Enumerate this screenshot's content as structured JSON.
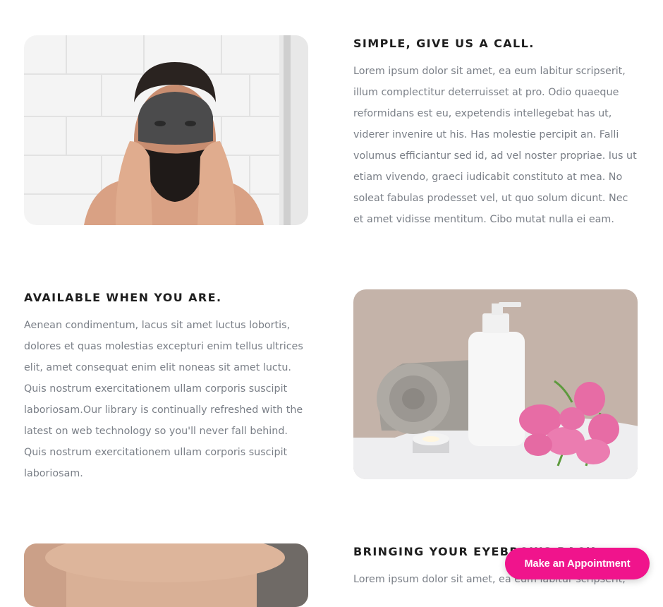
{
  "sections": [
    {
      "title": "SIMPLE, GIVE US A CALL.",
      "body": "Lorem ipsum dolor sit amet, ea eum labitur scripserit, illum complectitur deterruisset at pro. Odio quaeque reformidans est eu, expetendis intellegebat has ut, viderer invenire ut his. Has molestie percipit an. Falli volumus efficiantur sed id, ad vel noster propriae. Ius ut etiam vivendo, graeci iudicabit constituto at mea. No soleat fabulas prodesset vel, ut quo solum dicunt. Nec et amet vidisse mentitum. Cibo mutat nulla ei eam."
    },
    {
      "title": "AVAILABLE WHEN YOU ARE.",
      "body": "Aenean condimentum, lacus sit amet luctus lobortis, dolores et quas molestias excepturi enim tellus ultrices elit, amet consequat enim elit noneas sit amet luctu. Quis nostrum exercitationem ullam corporis suscipit laboriosam.Our library is continually refreshed with the latest on web technology so you'll never fall behind. Quis nostrum exercitationem ullam corporis suscipit laboriosam."
    },
    {
      "title": "BRINGING YOUR EYEBROWS BACK",
      "body": "Lorem ipsum dolor sit amet, ea eum labitur scripserit,"
    }
  ],
  "appointment_button": {
    "label": "Make an Appointment"
  },
  "colors": {
    "accent": "#f0148c",
    "heading": "#1e1e1e",
    "body": "#7a7f87"
  }
}
